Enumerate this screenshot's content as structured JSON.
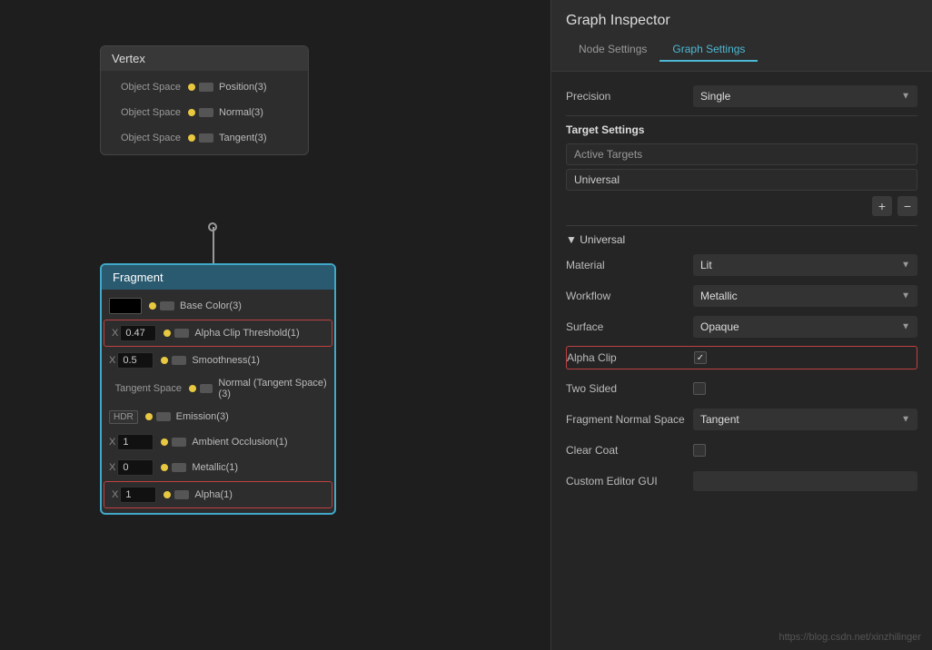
{
  "graph_inspector": {
    "title": "Graph Inspector",
    "tabs": [
      {
        "label": "Node Settings",
        "active": false
      },
      {
        "label": "Graph Settings",
        "active": true
      }
    ],
    "precision_label": "Precision",
    "precision_value": "Single",
    "target_settings_label": "Target Settings",
    "active_targets_label": "Active Targets",
    "universal_label": "Universal",
    "add_btn": "+",
    "remove_btn": "−",
    "universal_section": "▼ Universal",
    "fields": {
      "material_label": "Material",
      "material_value": "Lit",
      "workflow_label": "Workflow",
      "workflow_value": "Metallic",
      "surface_label": "Surface",
      "surface_value": "Opaque",
      "alpha_clip_label": "Alpha Clip",
      "two_sided_label": "Two Sided",
      "fragment_normal_label": "Fragment Normal Space",
      "fragment_normal_value": "Tangent",
      "clear_coat_label": "Clear Coat",
      "custom_editor_label": "Custom Editor GUI"
    }
  },
  "vertex_node": {
    "title": "Vertex",
    "ports": [
      {
        "label": "Object Space",
        "name": "Position(3)"
      },
      {
        "label": "Object Space",
        "name": "Normal(3)"
      },
      {
        "label": "Object Space",
        "name": "Tangent(3)"
      }
    ]
  },
  "fragment_node": {
    "title": "Fragment",
    "ports": [
      {
        "label": "",
        "name": "Base Color(3)",
        "input": "swatch"
      },
      {
        "label": "X 0.47",
        "name": "Alpha Clip Threshold(1)",
        "highlighted": true
      },
      {
        "label": "X 0.5",
        "name": "Smoothness(1)"
      },
      {
        "label": "Tangent Space",
        "name": "Normal (Tangent Space)(3)"
      },
      {
        "label": "HDR",
        "name": "Emission(3)"
      },
      {
        "label": "X 1",
        "name": "Ambient Occlusion(1)"
      },
      {
        "label": "X 0",
        "name": "Metallic(1)"
      },
      {
        "label": "X 1",
        "name": "Alpha(1)",
        "highlighted": true
      }
    ]
  },
  "watermark": "https://blog.csdn.net/xinzhilinger"
}
